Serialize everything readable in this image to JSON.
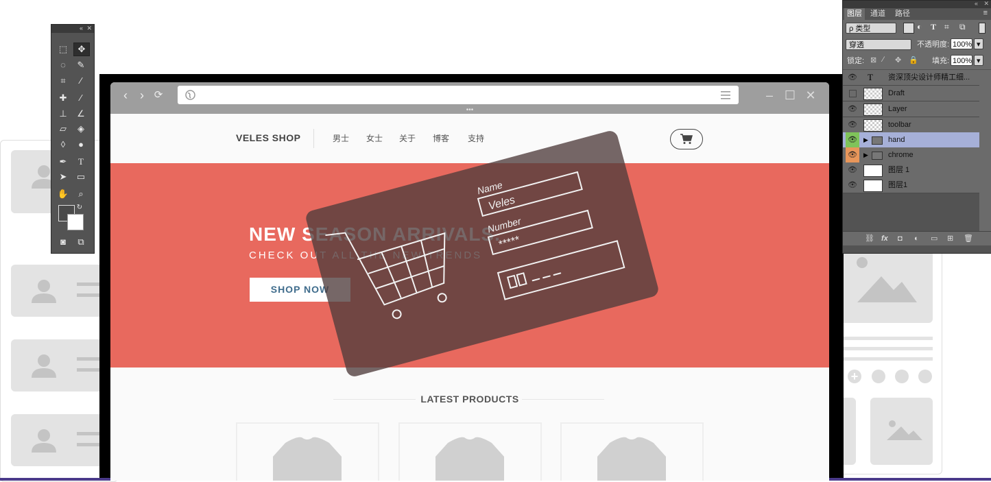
{
  "site": {
    "brand": "VELES SHOP",
    "nav": [
      "男士",
      "女士",
      "关于",
      "博客",
      "支持"
    ],
    "hero": {
      "title": "NEW SEASON ARRIVALS.",
      "subtitle": "CHECK OUT ALL THE NEW TRENDS",
      "cta": "SHOP NOW"
    },
    "section_title": "LATEST PRODUCTS"
  },
  "sketch_card": {
    "label_name": "Name",
    "value_name": "Veles",
    "label_number": "Number",
    "value_number": "*****"
  },
  "layers_panel": {
    "tabs": [
      "图层",
      "通道",
      "路径"
    ],
    "filter_label": "ρ 类型",
    "blend_mode": "穿透",
    "opacity_label": "不透明度:",
    "opacity_value": "100%",
    "lock_label": "锁定:",
    "fill_label": "填充:",
    "fill_value": "100%",
    "layers": [
      {
        "name": "资深顶尖设计师精工细...",
        "kind": "text",
        "visible": true
      },
      {
        "name": "Draft",
        "kind": "raster",
        "visible": false
      },
      {
        "name": "Layer",
        "kind": "smart",
        "visible": true
      },
      {
        "name": "toolbar",
        "kind": "smart",
        "visible": true
      },
      {
        "name": "hand",
        "kind": "group",
        "visible": true,
        "color": "#7fc35a"
      },
      {
        "name": "chrome",
        "kind": "group",
        "visible": true,
        "color": "#e8965a"
      },
      {
        "name": "图层 1",
        "kind": "raster",
        "visible": true
      },
      {
        "name": "图层1",
        "kind": "raster",
        "visible": true
      }
    ]
  },
  "colors": {
    "hero_bg": "#e8695e",
    "chrome_bg": "#9e9e9e",
    "panel_bg": "#535353",
    "selected_layer": "#a6b0d8"
  }
}
